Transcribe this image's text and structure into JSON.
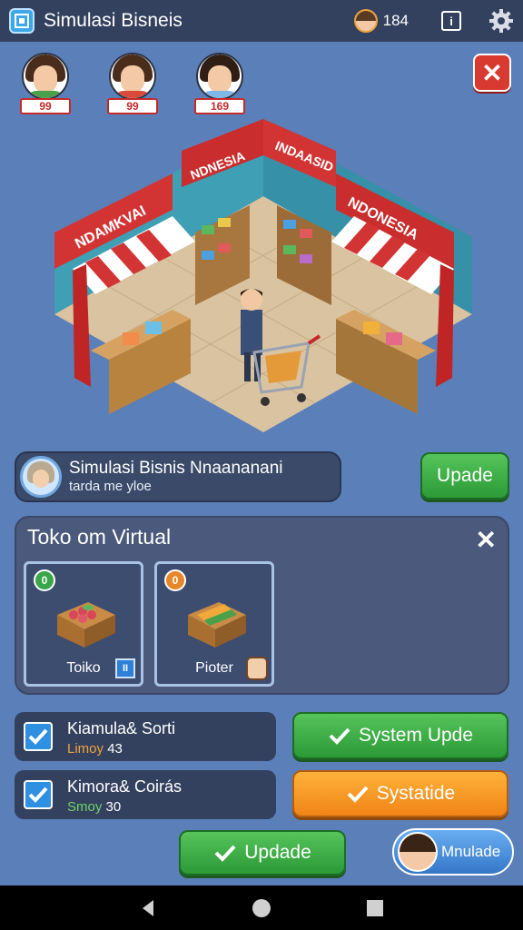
{
  "topbar": {
    "title": "Simulasi Bisneis",
    "coins": "184",
    "info_label": "i"
  },
  "players": [
    {
      "score": "99"
    },
    {
      "score": "99"
    },
    {
      "score": "169"
    }
  ],
  "close_label": "✕",
  "scene": {
    "sign_left": "NDAMKVAI",
    "sign_center_left": "NDNESIA",
    "sign_center_right": "INDAASID",
    "sign_right": "NDONESIA"
  },
  "info_bar": {
    "title": "Simulasi Bisnis  Nnaananani",
    "subtitle": "tarda me yloe"
  },
  "buttons": {
    "update_top": "Upade",
    "system_update": "System Upde",
    "systatide": "Systatide",
    "update_bottom": "Updade",
    "mnulade": "Mnulade"
  },
  "store": {
    "title": "Toko om Virtual",
    "close_label": "✕",
    "items": [
      {
        "label": "Toiko",
        "coin": "0",
        "tag": "II"
      },
      {
        "label": "Pioter",
        "coin": "0"
      }
    ]
  },
  "quests": [
    {
      "title": "Kiamula& Sorti",
      "label": "Limoy",
      "value": "43"
    },
    {
      "title": "Kimora& Coirás",
      "label": "Smoy",
      "value": "30"
    }
  ],
  "colors": {
    "background": "#5b7fb8",
    "topbar": "#33415f",
    "accent_red": "#d93a2f",
    "green": "#2b9a37",
    "orange": "#f08417",
    "blue": "#2f8fe0"
  }
}
